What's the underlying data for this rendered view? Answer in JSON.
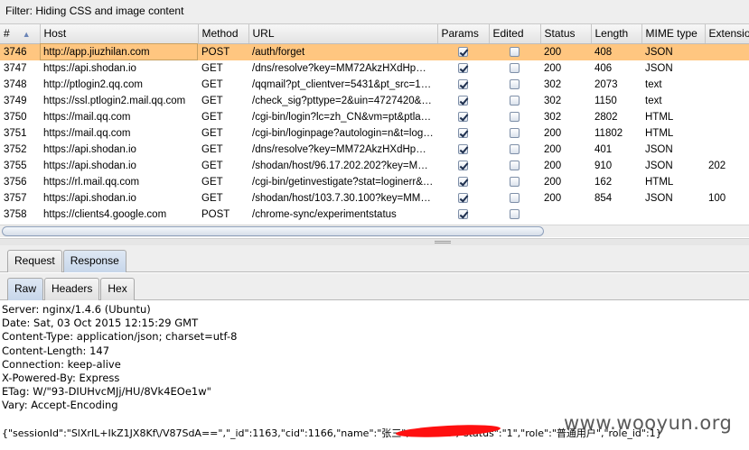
{
  "filter": {
    "text": "Filter:  Hiding CSS and image content"
  },
  "table": {
    "columns": [
      "#",
      "Host",
      "Method",
      "URL",
      "Params",
      "Edited",
      "Status",
      "Length",
      "MIME type",
      "Extension"
    ],
    "sort_indicator": "▲",
    "rows": [
      {
        "num": "3746",
        "host": "http://app.jiuzhilan.com",
        "method": "POST",
        "url": "/auth/forget",
        "params": true,
        "edited": false,
        "status": "200",
        "length": "408",
        "mime": "JSON",
        "ext": ""
      },
      {
        "num": "3747",
        "host": "https://api.shodan.io",
        "method": "GET",
        "url": "/dns/resolve?key=MM72AkzHXdHpC8iP...",
        "params": true,
        "edited": false,
        "status": "200",
        "length": "406",
        "mime": "JSON",
        "ext": ""
      },
      {
        "num": "3748",
        "host": "http://ptlogin2.qq.com",
        "method": "GET",
        "url": "/qqmail?pt_clientver=5431&pt_src=1&pt...",
        "params": true,
        "edited": false,
        "status": "302",
        "length": "2073",
        "mime": "text",
        "ext": ""
      },
      {
        "num": "3749",
        "host": "https://ssl.ptlogin2.mail.qq.com",
        "method": "GET",
        "url": "/check_sig?pttype=2&uin=4727420&se...",
        "params": true,
        "edited": false,
        "status": "302",
        "length": "1150",
        "mime": "text",
        "ext": ""
      },
      {
        "num": "3750",
        "host": "https://mail.qq.com",
        "method": "GET",
        "url": "/cgi-bin/login?lc=zh_CN&vm=pt&ptlang=...",
        "params": true,
        "edited": false,
        "status": "302",
        "length": "2802",
        "mime": "HTML",
        "ext": ""
      },
      {
        "num": "3751",
        "host": "https://mail.qq.com",
        "method": "GET",
        "url": "/cgi-bin/loginpage?autologin=n&t=loginp...",
        "params": true,
        "edited": false,
        "status": "200",
        "length": "11802",
        "mime": "HTML",
        "ext": ""
      },
      {
        "num": "3752",
        "host": "https://api.shodan.io",
        "method": "GET",
        "url": "/dns/resolve?key=MM72AkzHXdHpC8iP...",
        "params": true,
        "edited": false,
        "status": "200",
        "length": "401",
        "mime": "JSON",
        "ext": ""
      },
      {
        "num": "3755",
        "host": "https://api.shodan.io",
        "method": "GET",
        "url": "/shodan/host/96.17.202.202?key=MM7...",
        "params": true,
        "edited": false,
        "status": "200",
        "length": "910",
        "mime": "JSON",
        "ext": "202"
      },
      {
        "num": "3756",
        "host": "https://rl.mail.qq.com",
        "method": "GET",
        "url": "/cgi-bin/getinvestigate?stat=loginerr&co...",
        "params": true,
        "edited": false,
        "status": "200",
        "length": "162",
        "mime": "HTML",
        "ext": ""
      },
      {
        "num": "3757",
        "host": "https://api.shodan.io",
        "method": "GET",
        "url": "/shodan/host/103.7.30.100?key=MM72...",
        "params": true,
        "edited": false,
        "status": "200",
        "length": "854",
        "mime": "JSON",
        "ext": "100"
      },
      {
        "num": "3758",
        "host": "https://clients4.google.com",
        "method": "POST",
        "url": "/chrome-sync/experimentstatus",
        "params": true,
        "edited": false,
        "status": "",
        "length": "",
        "mime": "",
        "ext": ""
      }
    ]
  },
  "tabs_primary": [
    {
      "label": "Request",
      "active": false
    },
    {
      "label": "Response",
      "active": true
    }
  ],
  "tabs_secondary": [
    {
      "label": "Raw",
      "active": true
    },
    {
      "label": "Headers",
      "active": false
    },
    {
      "label": "Hex",
      "active": false
    }
  ],
  "response": {
    "headers": [
      "Server: nginx/1.4.6 (Ubuntu)",
      "Date: Sat, 03 Oct 2015 12:15:29 GMT",
      "Content-Type: application/json; charset=utf-8",
      "Content-Length: 147",
      "Connection: keep-alive",
      "X-Powered-By: Express",
      "ETag: W/\"93-DIUHvcMJj/HU/8Vk4EOe1w\"",
      "Vary: Accept-Encoding"
    ],
    "body": "{\"sessionId\":\"SlXrIL+IkZ1JX8Kf\\/V87SdA==\",\"_id\":1163,\"cid\":1166,\"name\":\"张三\",\"emai                        m\",\"status\":\"1\",\"role\":\"普通用户\",\"role_id\":1}"
  },
  "watermark": "www.wooyun.org",
  "colors": {
    "selected_row": "#ffc680",
    "redaction": "#ff1010"
  }
}
